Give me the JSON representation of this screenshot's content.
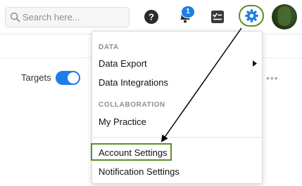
{
  "header": {
    "search": {
      "placeholder": "Search here...",
      "value": ""
    },
    "icons": {
      "search": "search-icon",
      "help": "help-icon",
      "notifications": "bell-icon",
      "tasks": "tasks-icon",
      "settings": "gear-icon",
      "avatar": "avatar"
    },
    "notification_count": "1"
  },
  "content": {
    "targets_label": "Targets",
    "targets_enabled": true,
    "more_dots": "•••"
  },
  "dropdown": {
    "sections": [
      {
        "heading": "DATA",
        "items": [
          {
            "label": "Data Export",
            "has_submenu": true
          },
          {
            "label": "Data Integrations"
          }
        ]
      },
      {
        "heading": "COLLABORATION",
        "items": [
          {
            "label": "My Practice"
          }
        ]
      },
      {
        "heading": "",
        "items": [
          {
            "label": "Account Settings",
            "highlighted": true
          },
          {
            "label": "Notification Settings"
          }
        ]
      }
    ]
  },
  "colors": {
    "accent_blue": "#1e7de8",
    "highlight_green": "#5a8f29",
    "section_gray": "#8e8e93"
  }
}
